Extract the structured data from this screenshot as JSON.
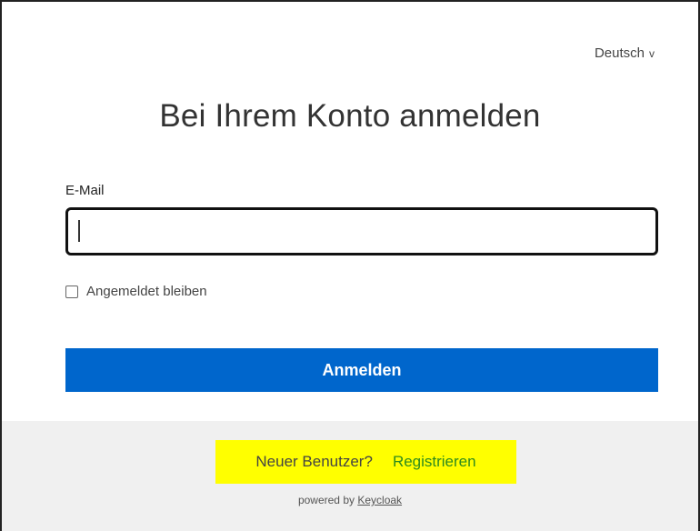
{
  "language": {
    "label": "Deutsch",
    "chevron": "v"
  },
  "title": "Bei Ihrem Konto anmelden",
  "form": {
    "email_label": "E-Mail",
    "email_value": "",
    "remember_label": "Angemeldet bleiben",
    "remember_checked": false,
    "submit_label": "Anmelden"
  },
  "footer": {
    "new_user_text": "Neuer Benutzer?",
    "register_link": "Registrieren",
    "powered_by": "powered by",
    "powered_link": "Keycloak"
  },
  "colors": {
    "primary_button": "#0066cc",
    "register_link": "#2e8b1e",
    "highlight": "#ffff00",
    "footer_bg": "#f0f0f0"
  }
}
